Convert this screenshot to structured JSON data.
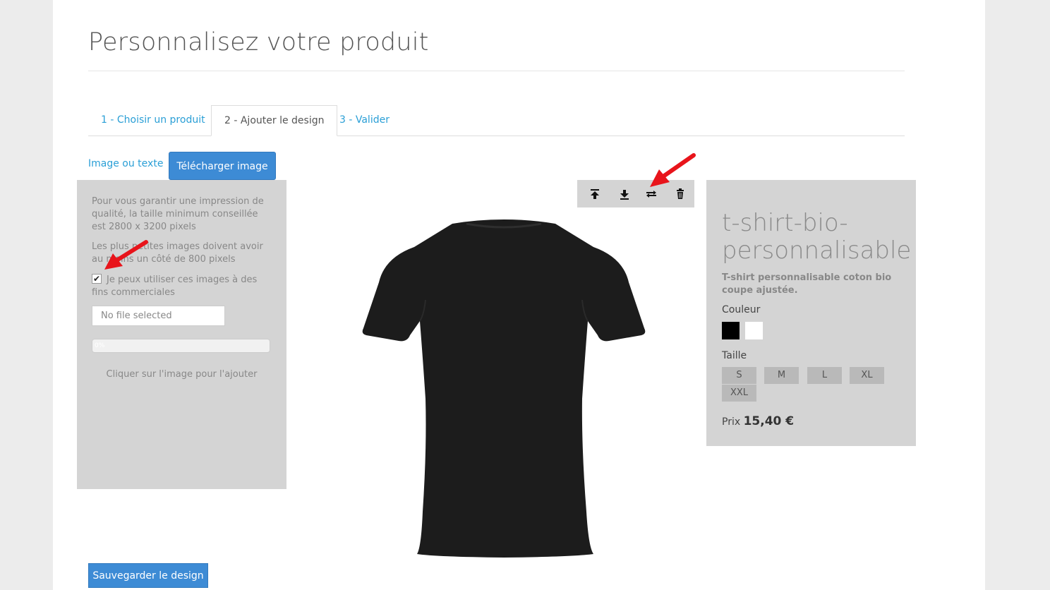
{
  "page": {
    "title": "Personnalisez votre produit"
  },
  "tabs": [
    {
      "label": "1 - Choisir un produit",
      "active": false
    },
    {
      "label": "2 - Ajouter le design",
      "active": true
    },
    {
      "label": "3 - Valider",
      "active": false
    }
  ],
  "design_tabs": {
    "image_or_text": "Image ou texte",
    "upload_image": "Télécharger image"
  },
  "upload_panel": {
    "quality_note": "Pour vous garantir une impression de qualité, la taille minimum conseillée est 2800 x 3200 pixels",
    "min_size_note": "Les plus petites images doivent avoir au moins un côté de 800 pixels",
    "commercial_checkbox_label": "Je peux utiliser ces images à des fins commerciales",
    "commercial_checked": true,
    "file_placeholder": "No file selected",
    "progress_text": "0%",
    "progress_value": 0,
    "click_hint": "Cliquer sur l'image pour l'ajouter"
  },
  "toolbar": {
    "icons": [
      "bring-to-front-icon",
      "send-to-back-icon",
      "swap-side-icon",
      "trash-icon"
    ]
  },
  "product": {
    "name": "t-shirt-bio-personnalisable",
    "description": "T-shirt personnalisable coton bio coupe ajustée.",
    "color_label": "Couleur",
    "colors": [
      "#000000",
      "#ffffff"
    ],
    "size_label": "Taille",
    "sizes": [
      "S",
      "M",
      "L",
      "XL",
      "XXL"
    ],
    "price_label": "Prix",
    "price": "15,40 €"
  },
  "save_button": "Sauvegarder le design",
  "colors": {
    "accent": "#3d8bd5",
    "link": "#2a9fd6",
    "panel": "#d4d4d4",
    "annotation_arrow": "#e8141b"
  }
}
